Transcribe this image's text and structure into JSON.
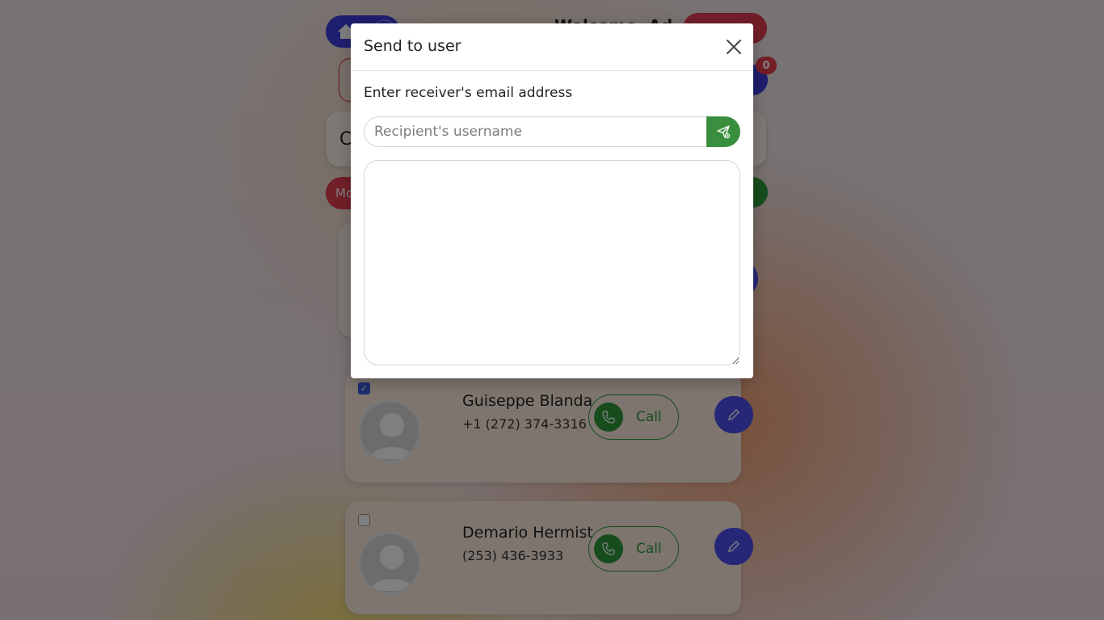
{
  "background": {
    "header_title": "Welcome, Ad",
    "notification_count": "0",
    "search_initial": "C",
    "more_button_label": "Mo",
    "contacts": [
      {
        "name": "Guiseppe Blanda",
        "phone": "+1 (272) 374-3316",
        "checked": true,
        "call_label": "Call"
      },
      {
        "name": "Demario Hermist",
        "phone": "(253) 436-3933",
        "checked": false,
        "call_label": "Call"
      }
    ]
  },
  "modal": {
    "title": "Send to user",
    "label": "Enter receiver's email address",
    "recipient_input": {
      "value": "",
      "placeholder": "Recipient's username"
    },
    "message_value": ""
  },
  "colors": {
    "primary": "#3f3fe0",
    "success": "#3a8f3f",
    "danger": "#e43e53"
  }
}
